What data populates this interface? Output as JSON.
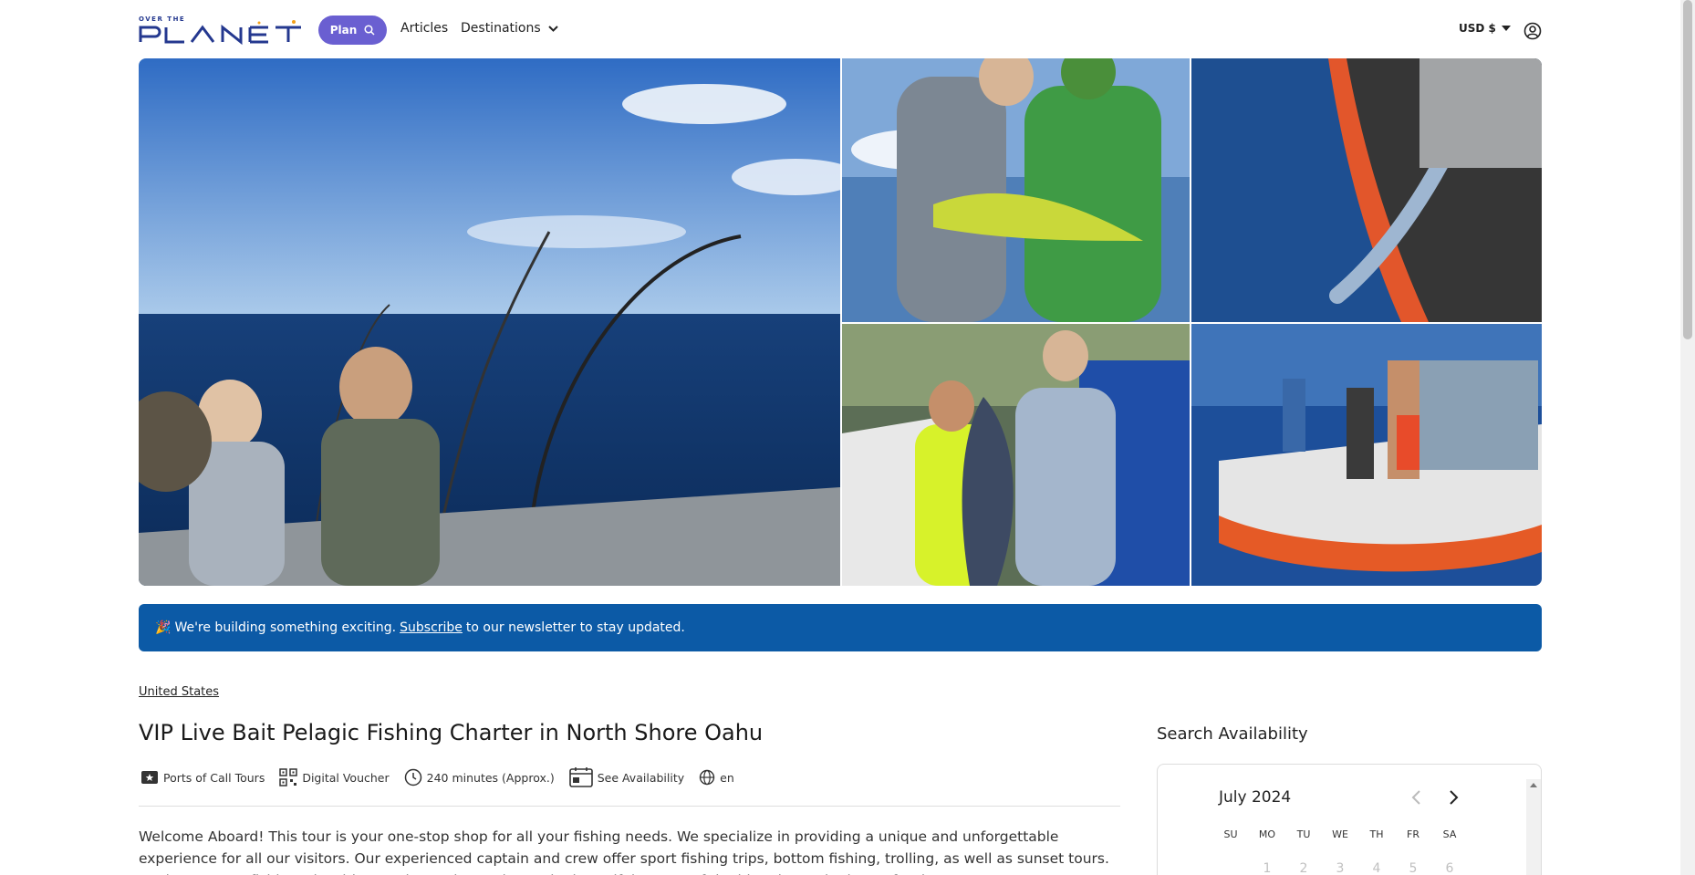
{
  "header": {
    "logo_small": "OVER THE",
    "logo_text": "PLANET",
    "plan_label": "Plan",
    "nav": {
      "articles": "Articles",
      "destinations": "Destinations"
    },
    "currency": "USD $"
  },
  "banner": {
    "icon": "🎉",
    "prefix": "We're building something exciting.",
    "link": "Subscribe",
    "suffix": "to our newsletter to stay updated."
  },
  "breadcrumb": "United States",
  "title": "VIP Live Bait Pelagic Fishing Charter in North Shore Oahu",
  "meta": {
    "category": "Ports of Call Tours",
    "voucher": "Digital Voucher",
    "duration": "240 minutes (Approx.)",
    "availability": "See Availability",
    "language": "en"
  },
  "description": "Welcome Aboard! This tour is your one-stop shop for all your fishing needs. We specialize in providing a unique and unforgettable experience for all our visitors. Our experienced captain and crew offer sport fishing trips, bottom fishing, trolling, as well as sunset tours. Book your next fishing trip with us today and experience the beautiful waters of the historic North Shore of Oahu.",
  "availability_panel": {
    "title": "Search Availability",
    "month": "July 2024",
    "weekdays": [
      "SU",
      "MO",
      "TU",
      "WE",
      "TH",
      "FR",
      "SA"
    ],
    "first_row_days": [
      "",
      "1",
      "2",
      "3",
      "4",
      "5",
      "6"
    ]
  },
  "colors": {
    "brand_blue": "#24388f",
    "plan_purple": "#6a5fd1",
    "banner_blue": "#0c5aa6"
  }
}
